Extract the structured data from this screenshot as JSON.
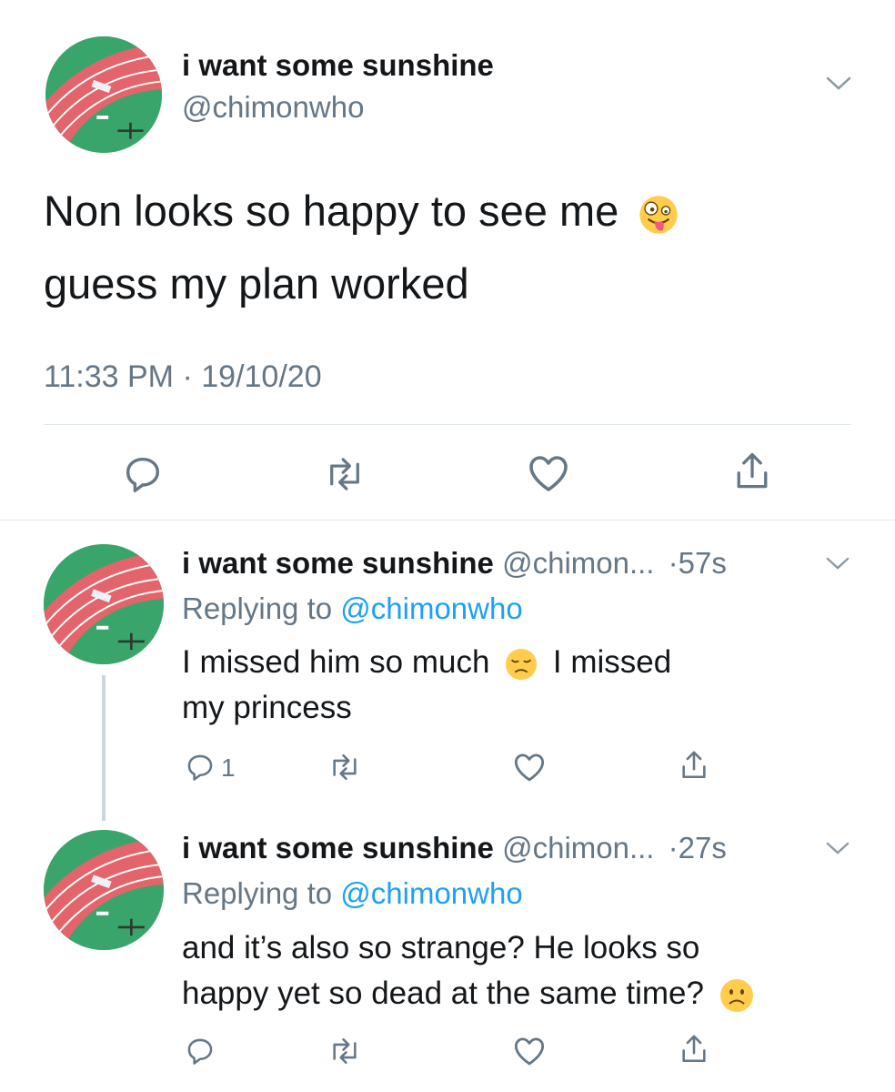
{
  "main_tweet": {
    "display_name": "i want some sunshine",
    "handle": "@chimonwho",
    "text_line1": "Non looks so happy to see me",
    "text_line2": "guess my plan worked",
    "emoji": "zany-face-emoji",
    "time": "11:33 PM",
    "separator": "·",
    "date": "19/10/20",
    "actions": [
      "reply-icon",
      "retweet-icon",
      "like-icon",
      "share-icon"
    ]
  },
  "replies": [
    {
      "display_name": "i want some sunshine",
      "handle": "@chimon...",
      "dot": "·",
      "age": "57s",
      "replying_prefix": "Replying to",
      "replying_handle": "@chimonwho",
      "line1_a": "I missed him so much",
      "line1_b": "I missed",
      "line2": "my princess",
      "emoji": "disappointed-face-emoji",
      "reply_count": "1"
    },
    {
      "display_name": "i want some sunshine",
      "handle": "@chimon...",
      "dot": "·",
      "age": "27s",
      "replying_prefix": "Replying to",
      "replying_handle": "@chimonwho",
      "line1": "and it’s also so strange? He looks so",
      "line2": "happy yet so dead at the same time?",
      "emoji": "frowning-face-emoji",
      "reply_count": ""
    }
  ],
  "colors": {
    "text": "#14171a",
    "secondary": "#657786",
    "link": "#1da1f2",
    "divider": "#e1e8ed",
    "thread_line": "#ccd6dd"
  }
}
